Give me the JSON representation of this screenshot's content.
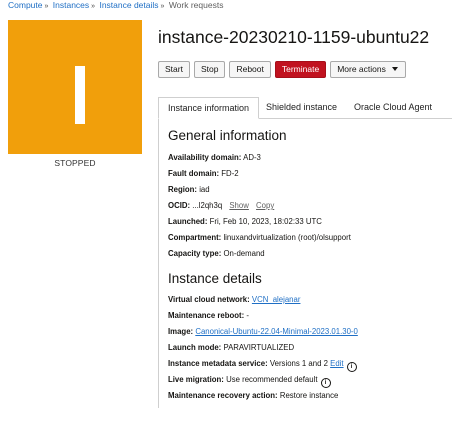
{
  "breadcrumb": {
    "items": [
      "Compute",
      "Instances",
      "Instance details"
    ],
    "current": "Work requests",
    "separator": "»"
  },
  "instance": {
    "name": "instance-20230210-1159-ubuntu22",
    "state": "STOPPED",
    "tile_color": "#f19f0b"
  },
  "actions": {
    "start": "Start",
    "stop": "Stop",
    "reboot": "Reboot",
    "terminate": "Terminate",
    "more": "More actions"
  },
  "tabs": [
    "Instance information",
    "Shielded instance",
    "Oracle Cloud Agent"
  ],
  "general": {
    "heading": "General information",
    "availability_domain": {
      "label": "Availability domain:",
      "value": "AD-3"
    },
    "fault_domain": {
      "label": "Fault domain:",
      "value": "FD-2"
    },
    "region": {
      "label": "Region:",
      "value": "iad"
    },
    "ocid": {
      "label": "OCID:",
      "value": "...l2qh3q",
      "show": "Show",
      "copy": "Copy"
    },
    "launched": {
      "label": "Launched:",
      "value": "Fri, Feb 10, 2023, 18:02:33 UTC"
    },
    "compartment": {
      "label": "Compartment:",
      "value": "linuxandvirtualization (root)/olsupport"
    },
    "capacity": {
      "label": "Capacity type:",
      "value": "On-demand"
    }
  },
  "details": {
    "heading": "Instance details",
    "vcn": {
      "label": "Virtual cloud network:",
      "value": "VCN_alejanar"
    },
    "maintenance_reboot": {
      "label": "Maintenance reboot:",
      "value": "-"
    },
    "image": {
      "label": "Image:",
      "value": "Canonical-Ubuntu-22.04-Minimal-2023.01.30-0"
    },
    "launch_mode": {
      "label": "Launch mode:",
      "value": "PARAVIRTUALIZED"
    },
    "metadata": {
      "label": "Instance metadata service:",
      "value": "Versions 1 and 2",
      "edit": "Edit"
    },
    "live_migration": {
      "label": "Live migration:",
      "value": "Use recommended default"
    },
    "recovery": {
      "label": "Maintenance recovery action:",
      "value": "Restore instance"
    }
  }
}
